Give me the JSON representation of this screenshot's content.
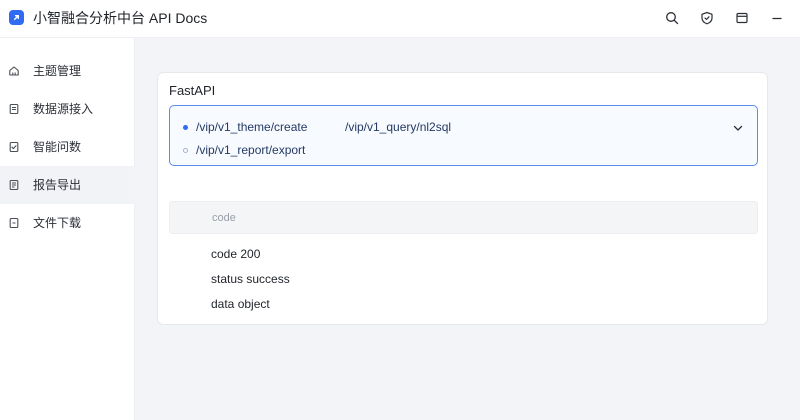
{
  "app": {
    "title": "小智融合分析中台  API Docs"
  },
  "toolbar": {
    "icons": [
      "search-icon",
      "shield-icon",
      "window-icon",
      "minimize-icon"
    ]
  },
  "sidebar": {
    "items": [
      {
        "label": "主题管理",
        "icon": "home-icon"
      },
      {
        "label": "数据源接入",
        "icon": "document-icon"
      },
      {
        "label": "智能问数",
        "icon": "checklist-icon"
      },
      {
        "label": "报告导出",
        "icon": "report-icon",
        "active": true
      },
      {
        "label": "文件下载",
        "icon": "file-icon"
      }
    ]
  },
  "card": {
    "title": "FastAPI",
    "endpoints": [
      {
        "path": "/vip/v1_theme/create",
        "selected": true
      },
      {
        "path": "/vip/v1_query/nl2sql",
        "selected": false
      },
      {
        "path": "/vip/v1_report/export",
        "selected": false
      }
    ],
    "code_header": "code",
    "response_lines": [
      "code 200",
      "status success",
      "data object"
    ]
  },
  "colors": {
    "accent": "#2f6bf3",
    "select_border": "#5b8def",
    "background": "#f3f4f7"
  }
}
